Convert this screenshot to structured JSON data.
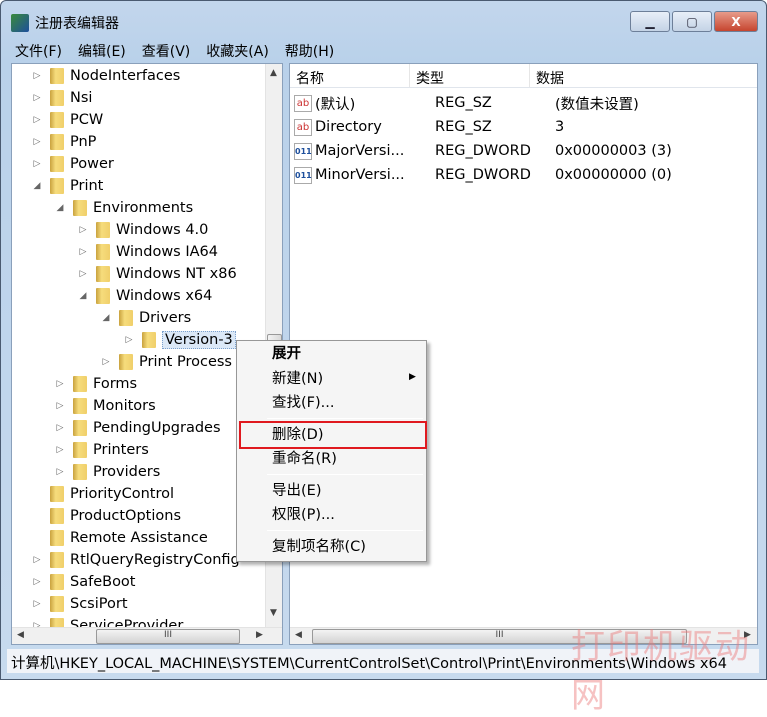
{
  "window": {
    "title": "注册表编辑器",
    "minimize": "▁",
    "maximize": "▢",
    "close": "X"
  },
  "menubar": [
    "文件(F)",
    "编辑(E)",
    "查看(V)",
    "收藏夹(A)",
    "帮助(H)"
  ],
  "tree": [
    {
      "label": "NodeInterfaces",
      "level": 0,
      "state": "collapsed"
    },
    {
      "label": "Nsi",
      "level": 0,
      "state": "collapsed"
    },
    {
      "label": "PCW",
      "level": 0,
      "state": "collapsed"
    },
    {
      "label": "PnP",
      "level": 0,
      "state": "collapsed"
    },
    {
      "label": "Power",
      "level": 0,
      "state": "collapsed"
    },
    {
      "label": "Print",
      "level": 0,
      "state": "expanded"
    },
    {
      "label": "Environments",
      "level": 1,
      "state": "expanded"
    },
    {
      "label": "Windows 4.0",
      "level": 2,
      "state": "collapsed"
    },
    {
      "label": "Windows IA64",
      "level": 2,
      "state": "collapsed"
    },
    {
      "label": "Windows NT x86",
      "level": 2,
      "state": "collapsed"
    },
    {
      "label": "Windows x64",
      "level": 2,
      "state": "expanded"
    },
    {
      "label": "Drivers",
      "level": 3,
      "state": "expanded"
    },
    {
      "label": "Version-3",
      "level": 4,
      "state": "collapsed",
      "selected": true
    },
    {
      "label": "Print Process",
      "level": 3,
      "state": "collapsed"
    },
    {
      "label": "Forms",
      "level": 1,
      "state": "collapsed"
    },
    {
      "label": "Monitors",
      "level": 1,
      "state": "collapsed"
    },
    {
      "label": "PendingUpgrades",
      "level": 1,
      "state": "collapsed"
    },
    {
      "label": "Printers",
      "level": 1,
      "state": "collapsed"
    },
    {
      "label": "Providers",
      "level": 1,
      "state": "collapsed"
    },
    {
      "label": "PriorityControl",
      "level": 0,
      "state": "none"
    },
    {
      "label": "ProductOptions",
      "level": 0,
      "state": "none"
    },
    {
      "label": "Remote Assistance",
      "level": 0,
      "state": "none"
    },
    {
      "label": "RtlQueryRegistryConfig",
      "level": 0,
      "state": "collapsed"
    },
    {
      "label": "SafeBoot",
      "level": 0,
      "state": "collapsed"
    },
    {
      "label": "ScsiPort",
      "level": 0,
      "state": "collapsed"
    },
    {
      "label": "ServiceProvider",
      "level": 0,
      "state": "collapsed"
    }
  ],
  "list": {
    "headers": [
      "名称",
      "类型",
      "数据"
    ],
    "rows": [
      {
        "icon": "string-value-icon",
        "name": "(默认)",
        "type": "REG_SZ",
        "data": "(数值未设置)"
      },
      {
        "icon": "string-value-icon",
        "name": "Directory",
        "type": "REG_SZ",
        "data": "3"
      },
      {
        "icon": "binary-value-icon",
        "name": "MajorVersi...",
        "type": "REG_DWORD",
        "data": "0x00000003 (3)"
      },
      {
        "icon": "binary-value-icon",
        "name": "MinorVersi...",
        "type": "REG_DWORD",
        "data": "0x00000000 (0)"
      }
    ]
  },
  "context_menu": {
    "items": [
      "展开",
      "新建(N)",
      "查找(F)...",
      "删除(D)",
      "重命名(R)",
      "导出(E)",
      "权限(P)...",
      "复制项名称(C)"
    ],
    "highlighted": "删除(D)",
    "highlight_color": "#e0191f"
  },
  "status": "计算机\\HKEY_LOCAL_MACHINE\\SYSTEM\\CurrentControlSet\\Control\\Print\\Environments\\Windows x64",
  "watermark": "打印机驱动网",
  "scroll": {
    "thumb": "III",
    "up": "▲",
    "down": "▼",
    "left": "◀",
    "right": "▶"
  }
}
